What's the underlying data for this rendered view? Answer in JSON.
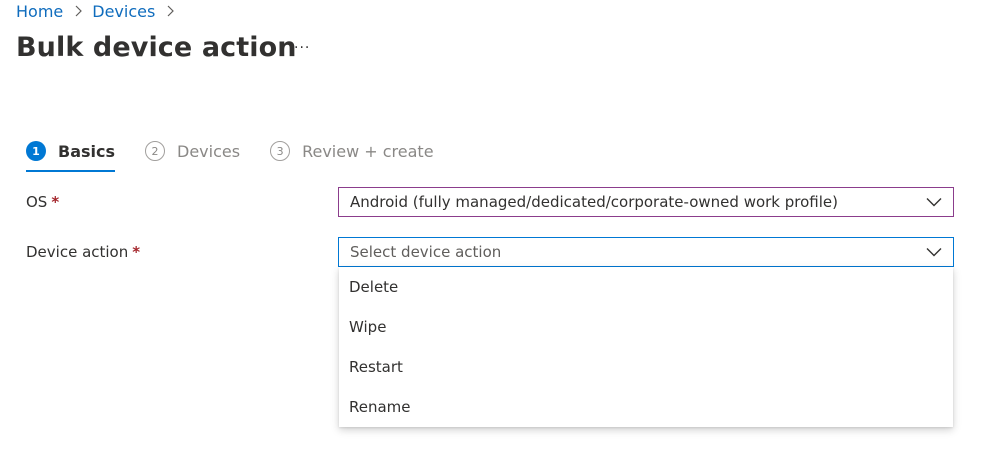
{
  "breadcrumb": {
    "items": [
      "Home",
      "Devices"
    ]
  },
  "page": {
    "title": "Bulk device action",
    "more_label": "···"
  },
  "steps": [
    {
      "num": "1",
      "label": "Basics",
      "state": "active"
    },
    {
      "num": "2",
      "label": "Devices",
      "state": "inactive"
    },
    {
      "num": "3",
      "label": "Review + create",
      "state": "inactive"
    }
  ],
  "form": {
    "os": {
      "label": "OS",
      "required_mark": "*",
      "value": "Android (fully managed/dedicated/corporate-owned work profile)"
    },
    "device_action": {
      "label": "Device action",
      "required_mark": "*",
      "placeholder": "Select device action"
    }
  },
  "dropdown": {
    "options": [
      "Delete",
      "Wipe",
      "Restart",
      "Rename"
    ]
  },
  "colors": {
    "accent": "#0078d4",
    "link": "#0f6cbd",
    "required": "#a4262c",
    "os_border": "#8b3d8c"
  },
  "icons": {
    "separator": "chevron-right-icon",
    "select": "chevron-down-icon",
    "more": "more-icon"
  }
}
